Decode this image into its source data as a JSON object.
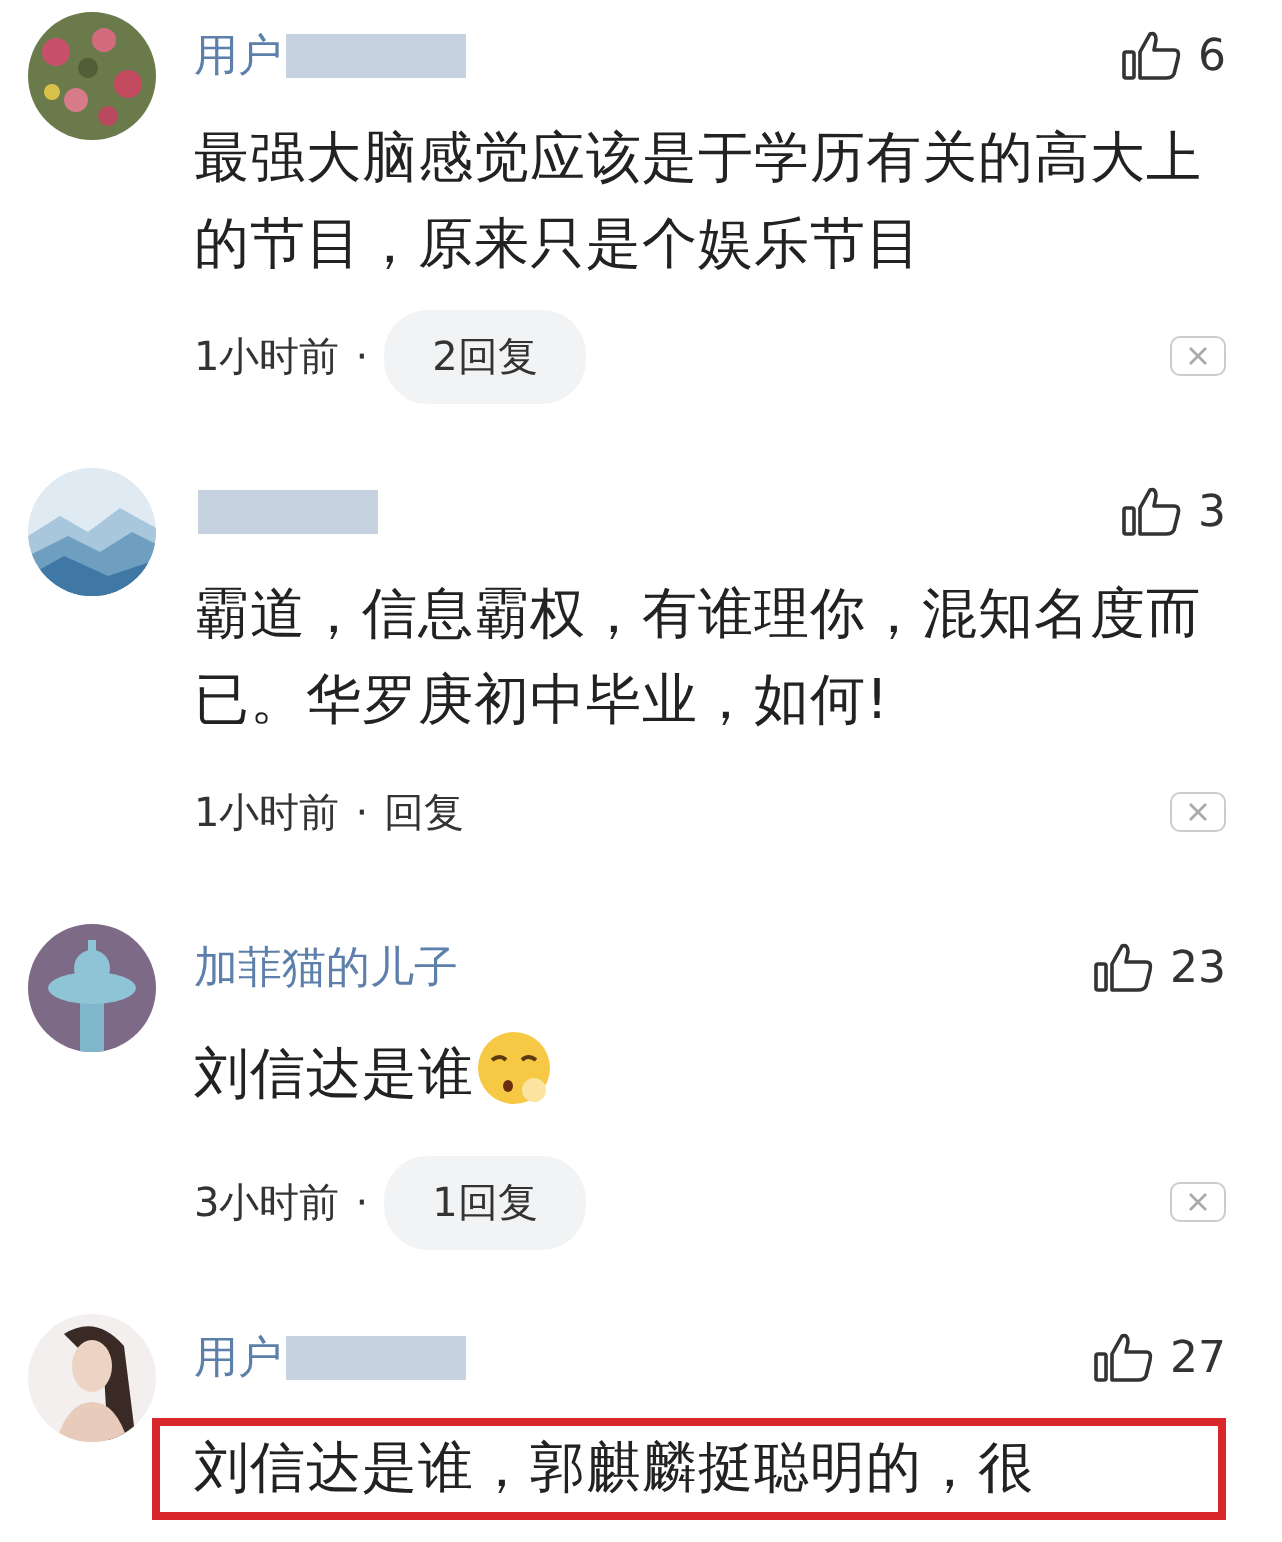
{
  "comments": [
    {
      "name": "用户",
      "masked": true,
      "likes": "6",
      "text": "最强大脑感觉应该是于学历有关的高大上的节目，原来只是个娱乐节目",
      "emoji": false,
      "time": "1小时前",
      "dot": "·",
      "reply": {
        "label": "2回复",
        "kind": "pill"
      },
      "highlighted": false
    },
    {
      "masked": true,
      "likes": "3",
      "text": "霸道，信息霸权，有谁理你，混知名度而已。华罗庚初中毕业，如何!",
      "emoji": false,
      "time": "1小时前",
      "dot": "·",
      "reply": {
        "label": "回复",
        "kind": "link"
      },
      "highlighted": false
    },
    {
      "name": "加菲猫的儿子",
      "masked": false,
      "likes": "23",
      "text": "刘信达是谁",
      "emoji": true,
      "time": "3小时前",
      "dot": "·",
      "reply": {
        "label": "1回复",
        "kind": "pill"
      },
      "highlighted": false
    },
    {
      "name": "用户",
      "masked": true,
      "likes": "27",
      "text": "刘信达是谁，郭麒麟挺聪明的，很",
      "emoji": false,
      "highlighted": true
    }
  ]
}
